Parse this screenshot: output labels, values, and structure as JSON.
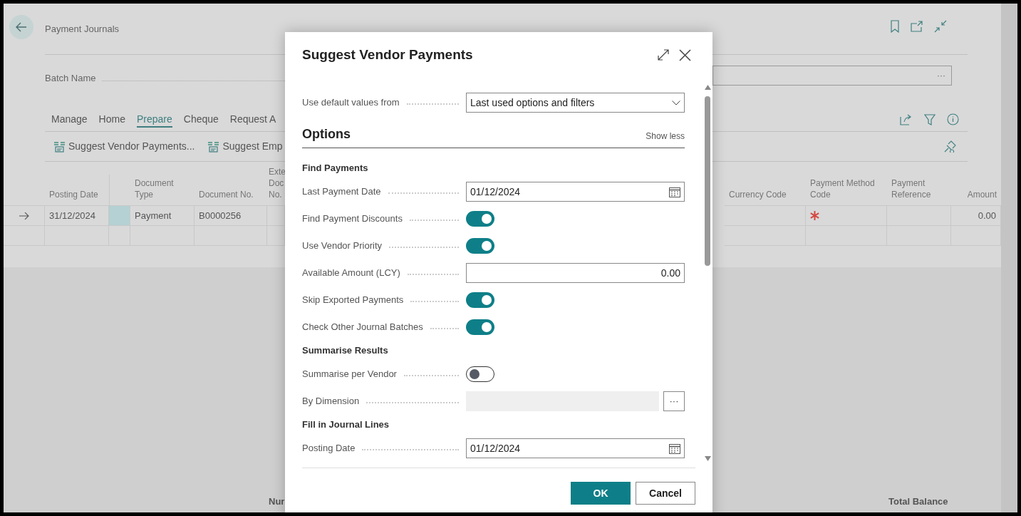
{
  "page": {
    "title": "Payment Journals",
    "batch_label": "Batch Name",
    "batch_lookup": "···"
  },
  "tabs": [
    {
      "label": "Manage",
      "selected": false
    },
    {
      "label": "Home",
      "selected": false
    },
    {
      "label": "Prepare",
      "selected": true
    },
    {
      "label": "Cheque",
      "selected": false
    },
    {
      "label": "Request A",
      "selected": false
    }
  ],
  "actions": [
    "Suggest Vendor Payments...",
    "Suggest Emp"
  ],
  "table": {
    "left_columns": [
      "",
      "Posting Date",
      "",
      "Document Type",
      "Document No.",
      "Exte Doc No."
    ],
    "right_columns": [
      "Currency Code",
      "Payment Method Code",
      "Payment Reference",
      "Amount"
    ],
    "rows": [
      {
        "current": true,
        "blank_cell_selected": true,
        "payment_method_required": true,
        "posting_date": "31/12/2024",
        "document_type": "Payment",
        "document_no": "B0000256",
        "amount": "0.00"
      },
      {
        "current": false,
        "blank_cell_selected": false,
        "payment_method_required": false
      }
    ]
  },
  "footer": {
    "column_1": "Nur",
    "total_label": "Total Balance"
  },
  "dialog": {
    "title": "Suggest Vendor Payments",
    "fields": [
      {
        "kind": "select",
        "label": "Use default values from",
        "value": "Last used options and filters"
      },
      {
        "kind": "section",
        "label": "Options",
        "link": "Show less"
      },
      {
        "kind": "heading",
        "label": "Find Payments"
      },
      {
        "kind": "date",
        "label": "Last Payment Date",
        "value": "01/12/2024"
      },
      {
        "kind": "toggle",
        "label": "Find Payment Discounts",
        "on": true
      },
      {
        "kind": "toggle",
        "label": "Use Vendor Priority",
        "on": true
      },
      {
        "kind": "amount",
        "label": "Available Amount (LCY)",
        "value": "0.00"
      },
      {
        "kind": "toggle",
        "label": "Skip Exported Payments",
        "on": true
      },
      {
        "kind": "toggle",
        "label": "Check Other Journal Batches",
        "on": true
      },
      {
        "kind": "heading",
        "label": "Summarise Results"
      },
      {
        "kind": "toggle",
        "label": "Summarise per Vendor",
        "on": false
      },
      {
        "kind": "lookup",
        "label": "By Dimension",
        "button": "···"
      },
      {
        "kind": "heading",
        "label": "Fill in Journal Lines"
      },
      {
        "kind": "date",
        "label": "Posting Date",
        "value": "01/12/2024"
      }
    ],
    "buttons": [
      {
        "label": "OK",
        "kind": "primary"
      },
      {
        "label": "Cancel",
        "kind": "secondary"
      }
    ]
  }
}
